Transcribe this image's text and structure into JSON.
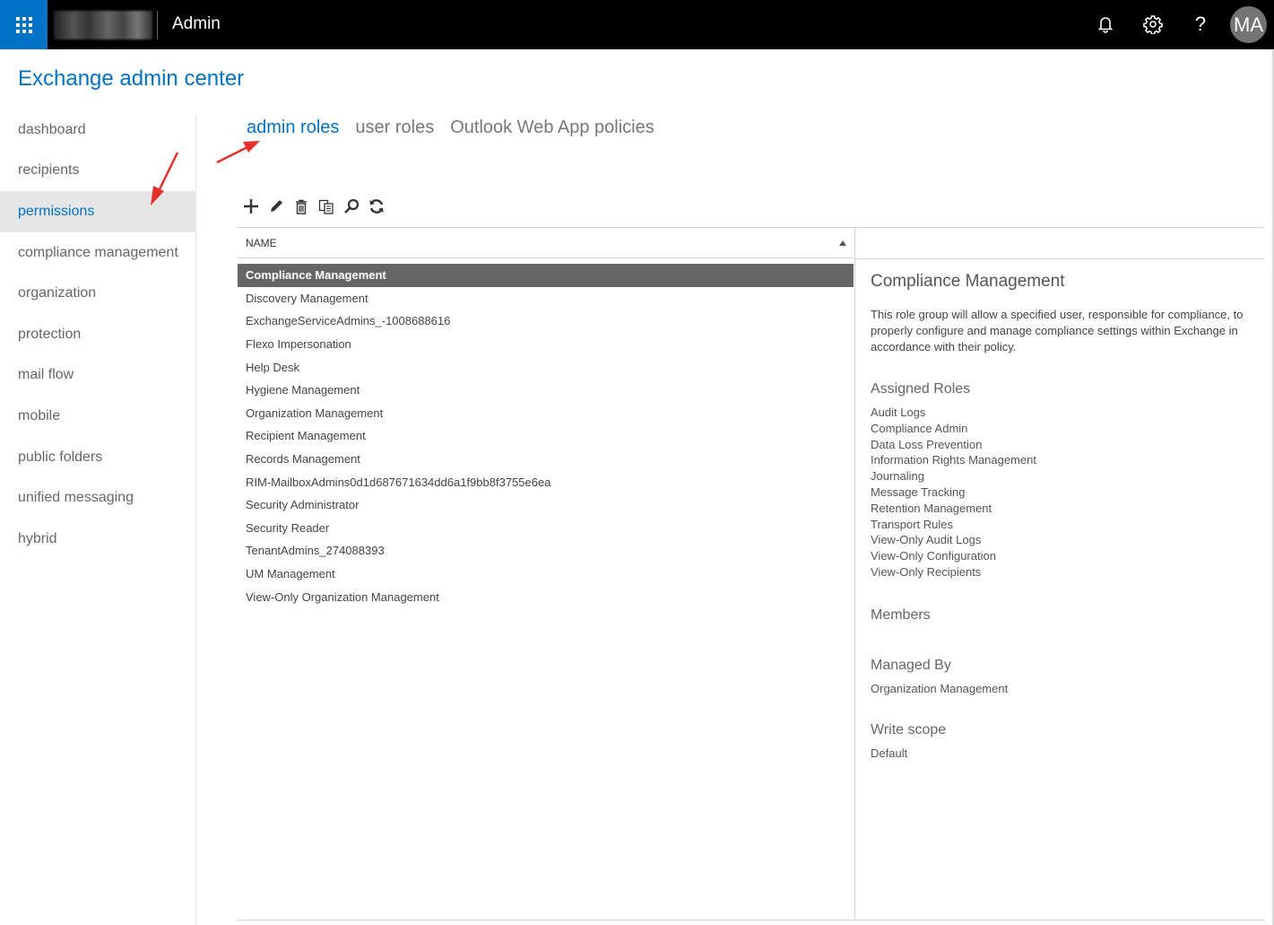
{
  "topbar": {
    "app_name": "Admin",
    "avatar_initials": "MA",
    "help_glyph": "?",
    "icons": [
      "waffle-icon",
      "bell-icon",
      "gear-icon",
      "help-icon"
    ],
    "colors": {
      "bar": "#000000",
      "waffle": "#0072c6",
      "avatar": "#737373"
    }
  },
  "header": {
    "title": "Exchange admin center"
  },
  "left_nav": {
    "items": [
      {
        "label": "dashboard"
      },
      {
        "label": "recipients"
      },
      {
        "label": "permissions",
        "active": true
      },
      {
        "label": "compliance management"
      },
      {
        "label": "organization"
      },
      {
        "label": "protection"
      },
      {
        "label": "mail flow"
      },
      {
        "label": "mobile"
      },
      {
        "label": "public folders"
      },
      {
        "label": "unified messaging"
      },
      {
        "label": "hybrid"
      }
    ]
  },
  "tabs": [
    {
      "label": "admin roles",
      "active": true
    },
    {
      "label": "user roles"
    },
    {
      "label": "Outlook Web App policies"
    }
  ],
  "toolbar": {
    "icons": [
      "add-icon",
      "edit-icon",
      "delete-icon",
      "copy-icon",
      "search-icon",
      "refresh-icon"
    ]
  },
  "list": {
    "column_header": "NAME",
    "sort": "ascending",
    "rows": [
      {
        "name": "Compliance Management",
        "selected": true
      },
      {
        "name": "Discovery Management"
      },
      {
        "name": "ExchangeServiceAdmins_-1008688616"
      },
      {
        "name": "Flexo Impersonation"
      },
      {
        "name": "Help Desk"
      },
      {
        "name": "Hygiene Management"
      },
      {
        "name": "Organization Management"
      },
      {
        "name": "Recipient Management"
      },
      {
        "name": "Records Management"
      },
      {
        "name": "RIM-MailboxAdmins0d1d687671634dd6a1f9bb8f3755e6ea"
      },
      {
        "name": "Security Administrator"
      },
      {
        "name": "Security Reader"
      },
      {
        "name": "TenantAdmins_274088393"
      },
      {
        "name": "UM Management"
      },
      {
        "name": "View-Only Organization Management"
      }
    ]
  },
  "details": {
    "title": "Compliance Management",
    "description": "This role group will allow a specified user, responsible for compliance, to properly configure and manage compliance settings within Exchange in accordance with their policy.",
    "assigned_roles_label": "Assigned Roles",
    "assigned_roles": [
      "Audit Logs",
      "Compliance Admin",
      "Data Loss Prevention",
      "Information Rights Management",
      "Journaling",
      "Message Tracking",
      "Retention Management",
      "Transport Rules",
      "View-Only Audit Logs",
      "View-Only Configuration",
      "View-Only Recipients"
    ],
    "members_label": "Members",
    "managed_by_label": "Managed By",
    "managed_by": "Organization Management",
    "write_scope_label": "Write scope",
    "write_scope": "Default"
  },
  "annotations": {
    "arrow_color": "#e8302a"
  }
}
